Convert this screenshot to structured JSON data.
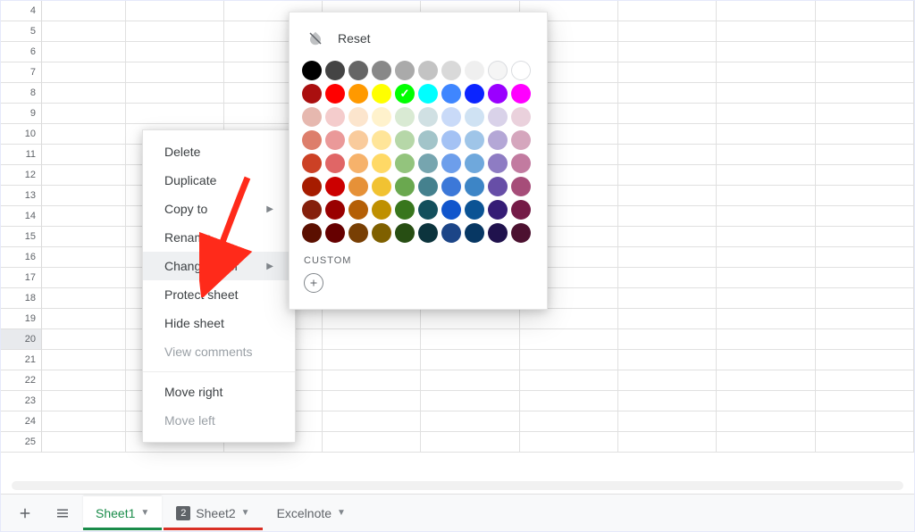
{
  "rows_start": 4,
  "rows_end": 25,
  "selected_row": 20,
  "context_menu": {
    "items": [
      {
        "label": "Delete",
        "disabled": false,
        "submenu": false,
        "hover": false
      },
      {
        "label": "Duplicate",
        "disabled": false,
        "submenu": false,
        "hover": false
      },
      {
        "label": "Copy to",
        "disabled": false,
        "submenu": true,
        "hover": false
      },
      {
        "label": "Rename",
        "disabled": false,
        "submenu": false,
        "hover": false
      },
      {
        "label": "Change color",
        "disabled": false,
        "submenu": true,
        "hover": true
      },
      {
        "label": "Protect sheet",
        "disabled": false,
        "submenu": false,
        "hover": false
      },
      {
        "label": "Hide sheet",
        "disabled": false,
        "submenu": false,
        "hover": false
      },
      {
        "label": "View comments",
        "disabled": true,
        "submenu": false,
        "hover": false
      },
      {
        "sep": true
      },
      {
        "label": "Move right",
        "disabled": false,
        "submenu": false,
        "hover": false
      },
      {
        "label": "Move left",
        "disabled": true,
        "submenu": false,
        "hover": false
      }
    ]
  },
  "color_popover": {
    "reset": "Reset",
    "custom_label": "CUSTOM",
    "selected_index": 14,
    "colors": [
      "#000000",
      "#444444",
      "#666666",
      "#888888",
      "#aaaaaa",
      "#c3c3c3",
      "#d9d9d9",
      "#efefef",
      "#f5f5f5",
      "#ffffff",
      "#aa0f0f",
      "#ff0000",
      "#ff9900",
      "#ffff00",
      "#00ff00",
      "#00ffff",
      "#3f86ff",
      "#0b24ff",
      "#9a00ff",
      "#ff00ff",
      "#e6b8af",
      "#f4cccc",
      "#fce5cd",
      "#fff2cc",
      "#d9ead3",
      "#d0e0e3",
      "#c9daf8",
      "#cfe2f3",
      "#d9d2e9",
      "#ead1dc",
      "#dd7e6b",
      "#ea9999",
      "#f9cb9c",
      "#ffe599",
      "#b6d7a8",
      "#a2c4c9",
      "#a4c2f4",
      "#9fc5e8",
      "#b4a7d6",
      "#d5a6bd",
      "#cc4125",
      "#e06666",
      "#f6b26b",
      "#ffd966",
      "#93c47d",
      "#76a5af",
      "#6d9eeb",
      "#6fa8dc",
      "#8e7cc3",
      "#c27ba0",
      "#a61c00",
      "#cc0000",
      "#e69138",
      "#f1c232",
      "#6aa84f",
      "#45818e",
      "#3c78d8",
      "#3d85c6",
      "#674ea7",
      "#a64d79",
      "#85200c",
      "#990000",
      "#b45f06",
      "#bf9000",
      "#38761d",
      "#134f5c",
      "#1155cc",
      "#0b5394",
      "#351c75",
      "#741b47",
      "#5b0f00",
      "#660000",
      "#783f04",
      "#7f6000",
      "#274e13",
      "#0c343d",
      "#1c4587",
      "#073763",
      "#20124d",
      "#4c1130"
    ]
  },
  "tabs": {
    "add_tooltip": "Add Sheet",
    "all_tooltip": "All Sheets",
    "list": [
      {
        "name": "Sheet1",
        "active": true,
        "underline": "#1a8c4a"
      },
      {
        "name": "Sheet2",
        "active": false,
        "badge": "2",
        "underline": "#d93025"
      },
      {
        "name": "Excelnote",
        "active": false
      }
    ]
  }
}
